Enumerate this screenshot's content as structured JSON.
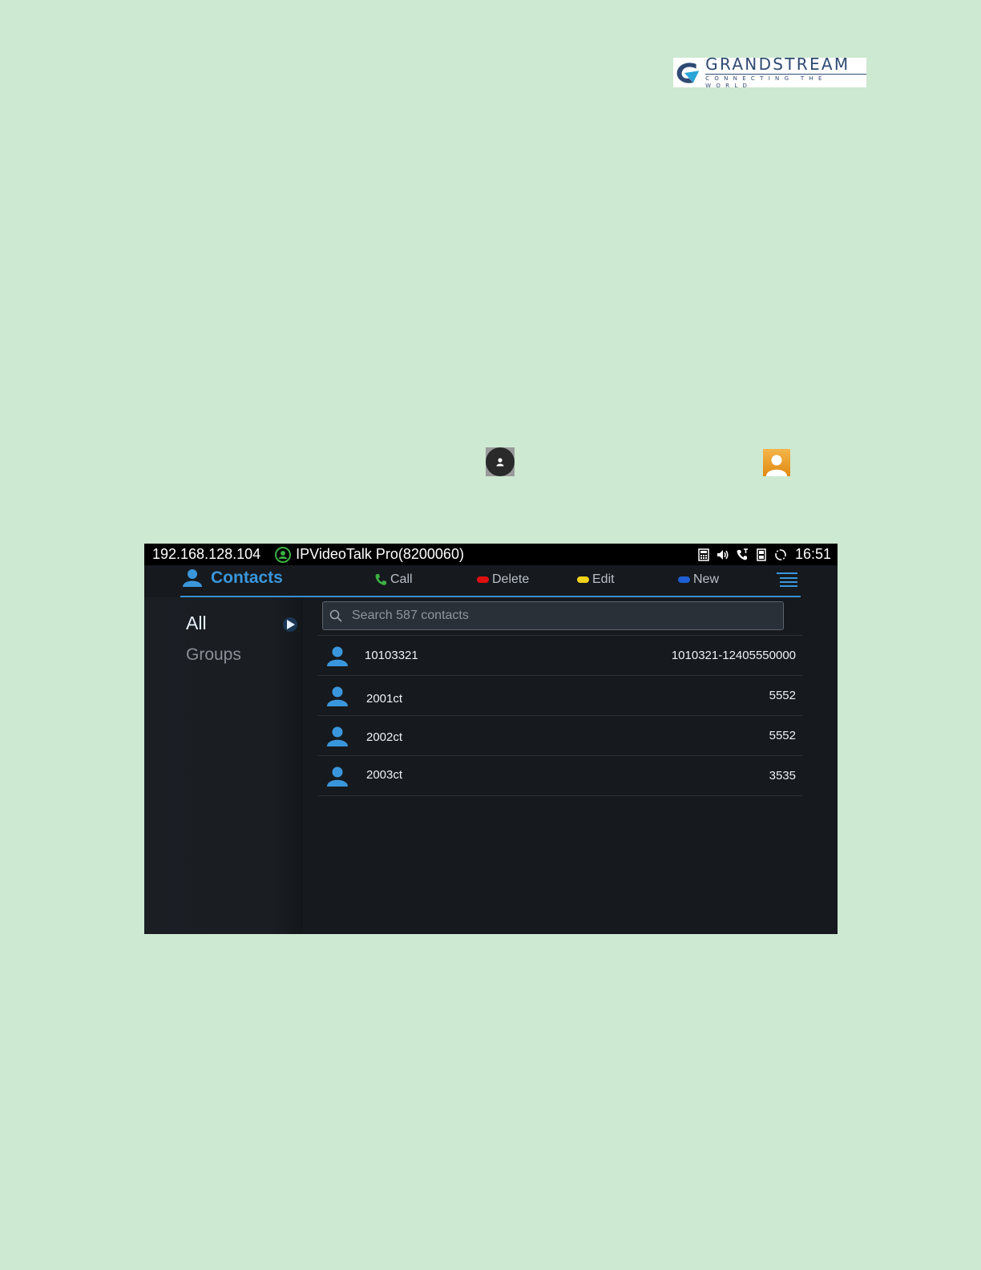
{
  "logo": {
    "brand": "GRANDSTREAM",
    "tagline": "CONNECTING THE WORLD"
  },
  "status_bar": {
    "ip": "192.168.128.104",
    "account": "IPVideoTalk Pro(8200060)",
    "time": "16:51"
  },
  "header": {
    "title": "Contacts",
    "softkeys": {
      "call": "Call",
      "delete": "Delete",
      "edit": "Edit",
      "new": "New"
    }
  },
  "sidebar": {
    "items": [
      "All",
      "Groups"
    ]
  },
  "search": {
    "placeholder": "Search 587 contacts"
  },
  "contacts": [
    {
      "name": "10103321",
      "number": "1010321-12405550000"
    },
    {
      "name": "2001ct",
      "number": "5552"
    },
    {
      "name": "2002ct",
      "number": "5552"
    },
    {
      "name": "2003ct",
      "number": "3535"
    }
  ],
  "colors": {
    "page_bg": "#cde9d1",
    "accent_blue": "#3a96dc",
    "call_green": "#3cb043",
    "delete_red": "#e01010",
    "edit_yellow": "#f2d21b",
    "new_blue": "#1f5fd6"
  }
}
